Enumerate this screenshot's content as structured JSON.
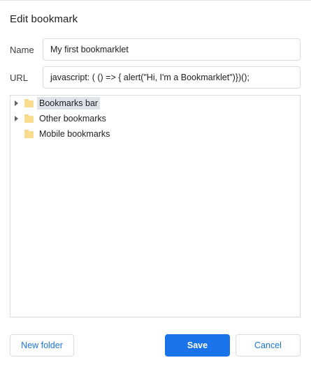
{
  "dialog": {
    "title": "Edit bookmark"
  },
  "form": {
    "name_label": "Name",
    "name_value": "My first  bookmarklet",
    "url_label": "URL",
    "url_value": "javascript: ( () => { alert(\"Hi, I'm a Bookmarklet\")})();"
  },
  "tree": {
    "items": [
      {
        "label": "Bookmarks bar",
        "expandable": true,
        "selected": true,
        "icon": "folder-icon"
      },
      {
        "label": "Other bookmarks",
        "expandable": true,
        "selected": false,
        "icon": "folder-icon"
      },
      {
        "label": "Mobile bookmarks",
        "expandable": false,
        "selected": false,
        "icon": "folder-icon"
      }
    ]
  },
  "buttons": {
    "new_folder": "New folder",
    "save": "Save",
    "cancel": "Cancel"
  },
  "colors": {
    "accent": "#1a73e8",
    "selection": "#dfe2e7",
    "folder": "#f9dc8d",
    "border": "#dadce0"
  }
}
